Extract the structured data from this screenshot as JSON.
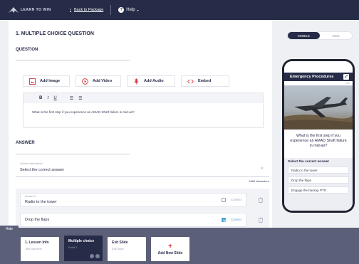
{
  "topbar": {
    "logo_text": "LEARN TO WIN",
    "back_label": "Back to Package",
    "help_label": "Help"
  },
  "editor": {
    "question_title": "1. MULTIPLE CHOICE QUESTION",
    "question_label": "QUESTION",
    "media_buttons": {
      "image": "Add Image",
      "video": "Add Video",
      "audio": "Add Audio",
      "embed": "Embed"
    },
    "toolbar": {
      "bold": "B",
      "italic": "I",
      "underline": "U"
    },
    "question_text": "What is the first step if you experience an AMAD Shaft failure in mid-air?",
    "answer_label": "ANSWER",
    "instructions_label": "Learner instructions*",
    "instructions_value": "Select the correct answer",
    "char_count": "2488 characters",
    "answers": [
      {
        "label": "Answer 1*",
        "value": "Radio to the tower",
        "correct": false,
        "correct_label": "Correct"
      },
      {
        "label": "",
        "value": "Drop the flaps",
        "correct": true,
        "correct_label": "Correct"
      }
    ]
  },
  "preview": {
    "toggle": {
      "mobile": "MOBILE",
      "web": "WEB"
    },
    "header_title": "Emergency Procedures",
    "progress_text": "70%",
    "question_text": "What is the first step if you experience an AMAD Shaft failure in mid-air?",
    "select_label": "Select the correct answer",
    "options": [
      "Radio to the tower",
      "Drop the flaps",
      "Engage the backup PTO"
    ]
  },
  "slides": {
    "hide_label": "Hide",
    "items": [
      {
        "title": "1. Lesson Info",
        "subtitle": "Title and time"
      },
      {
        "title": "Multiple choice",
        "subtitle": "Point 1"
      },
      {
        "title": "Exit Slide",
        "subtitle": "Exit Slide"
      }
    ],
    "add_label": "Add New Slide"
  },
  "colors": {
    "navy": "#262c47",
    "accent_red": "#d5343b",
    "check_blue": "#4aa3d9",
    "slidebar": "#5b5f78"
  }
}
